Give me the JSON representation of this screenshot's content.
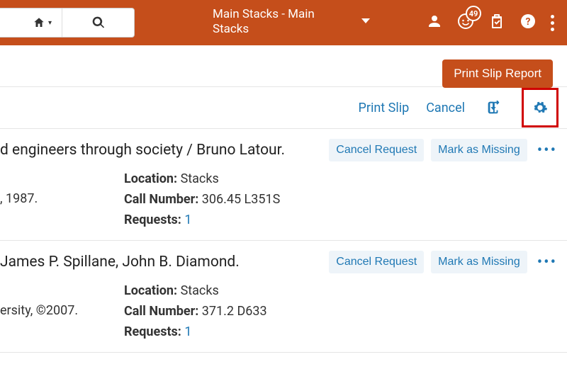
{
  "header": {
    "location": "Main Stacks - Main Stacks",
    "notification_count": "49"
  },
  "top": {
    "print_slip_report": "Print Slip Report"
  },
  "toolbar": {
    "print_slip": "Print Slip",
    "cancel": "Cancel"
  },
  "labels": {
    "location": "Location:",
    "call_number": "Call Number:",
    "requests": "Requests:",
    "cancel_request": "Cancel Request",
    "mark_missing": "Mark as Missing"
  },
  "items": [
    {
      "title": "d engineers through society / Bruno Latour.",
      "location": "Stacks",
      "call_number": "306.45 L351S",
      "requests": "1",
      "pub": ", 1987."
    },
    {
      "title": "James P. Spillane, John B. Diamond.",
      "location": "Stacks",
      "call_number": "371.2 D633",
      "requests": "1",
      "pub": "ersity, ©2007."
    }
  ]
}
